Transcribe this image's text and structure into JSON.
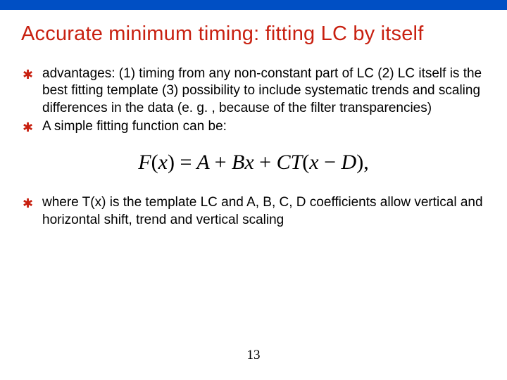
{
  "slide": {
    "title": "Accurate minimum timing: fitting LC by itself",
    "bullets": {
      "b1": "advantages: (1) timing from any non-constant part of LC (2) LC itself is the best fitting template (3) possibility to include systematic trends and scaling differences in the data (e. g. , because of the filter transparencies)",
      "b2": "A simple fitting function can be:",
      "b3": "where T(x) is the template LC and A, B, C, D coefficients allow vertical and horizontal shift, trend and vertical scaling"
    },
    "formula_plain": "F(x) = A + Bx + CT(x − D),",
    "page_number": "13"
  }
}
